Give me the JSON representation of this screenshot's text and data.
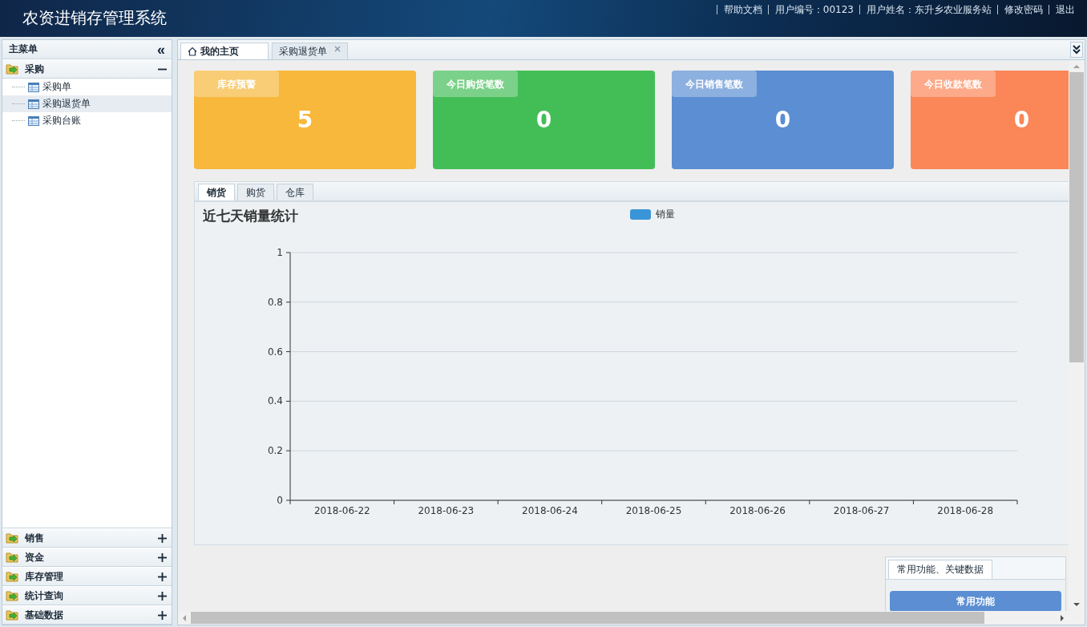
{
  "header": {
    "title": "农资进销存管理系统",
    "links": [
      "帮助文档",
      "用户编号：00123",
      "用户姓名：东升乡农业服务站",
      "修改密码",
      "退出"
    ]
  },
  "sidebar": {
    "title": "主菜单",
    "collapse_icon": "«",
    "groups": [
      {
        "label": "采购",
        "expanded": true,
        "items": [
          {
            "label": "采购单",
            "selected": false
          },
          {
            "label": "采购退货单",
            "selected": true
          },
          {
            "label": "采购台账",
            "selected": false
          }
        ]
      },
      {
        "label": "销售",
        "expanded": false
      },
      {
        "label": "资金",
        "expanded": false
      },
      {
        "label": "库存管理",
        "expanded": false
      },
      {
        "label": "统计查询",
        "expanded": false
      },
      {
        "label": "基础数据",
        "expanded": false
      }
    ]
  },
  "tabs": [
    {
      "label": "我的主页",
      "selected": true,
      "closable": false
    },
    {
      "label": "采购退货单",
      "selected": false,
      "closable": true
    }
  ],
  "cards": [
    {
      "title": "库存预警",
      "value": "5",
      "color": "#f7b83b"
    },
    {
      "title": "今日购货笔数",
      "value": "0",
      "color": "#43be57"
    },
    {
      "title": "今日销售笔数",
      "value": "0",
      "color": "#5b8ed2"
    },
    {
      "title": "今日收款笔数",
      "value": "0",
      "color": "#fb8658"
    }
  ],
  "chart_panel": {
    "tabs": [
      {
        "label": "销货",
        "selected": true
      },
      {
        "label": "购货",
        "selected": false
      },
      {
        "label": "仓库",
        "selected": false
      }
    ],
    "title": "近七天销量统计",
    "chart_data": {
      "type": "bar",
      "categories": [
        "2018-06-22",
        "2018-06-23",
        "2018-06-24",
        "2018-06-25",
        "2018-06-26",
        "2018-06-27",
        "2018-06-28"
      ],
      "series": [
        {
          "name": "销量",
          "color": "#3a95d8",
          "values": [
            0,
            0,
            0,
            0,
            0,
            0,
            0
          ]
        }
      ],
      "grid": true,
      "ylim": [
        0,
        1
      ],
      "yticks": [
        0,
        0.2,
        0.4,
        0.6,
        0.8,
        1
      ]
    }
  },
  "key_panel": {
    "tab": "常用功能、关键数据",
    "button": "常用功能"
  }
}
